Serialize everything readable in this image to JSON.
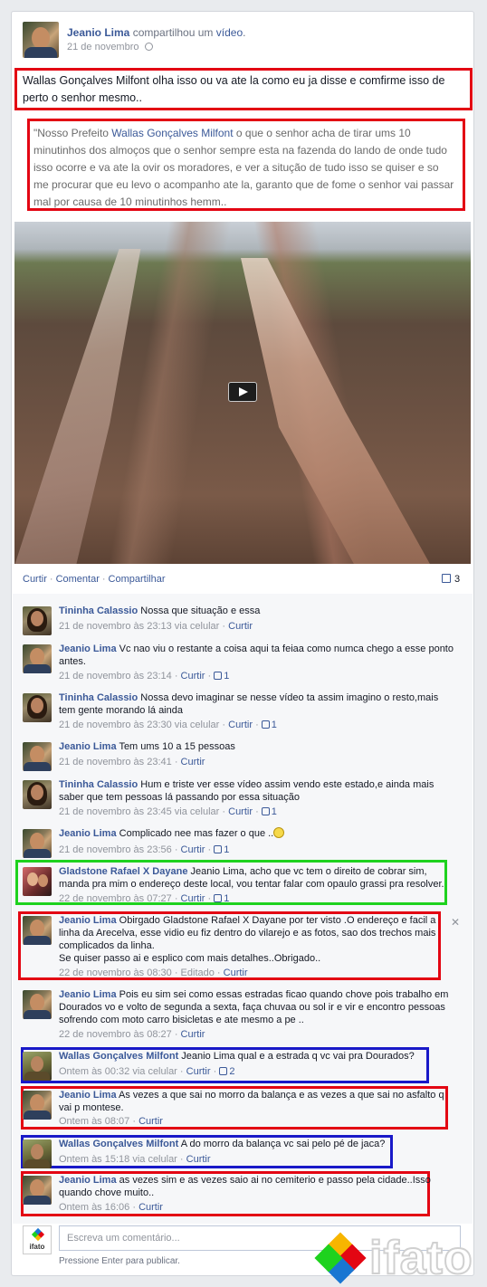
{
  "post": {
    "author": "Jeanio Lima",
    "action_text": "compartilhou um",
    "action_link": "vídeo",
    "action_end": ".",
    "date": "21 de novembro",
    "message": "Wallas Gonçalves Milfont olha isso ou va ate la como eu ja disse e comfirme isso de perto o senhor mesmo..",
    "quote_start": "\"Nosso Prefeito ",
    "quote_link": "Wallas Gonçalves Milfont",
    "quote_rest": " o que o senhor acha de tirar ums 10 minutinhos dos almoços que o senhor sempre esta na fazenda do lando de onde tudo isso ocorre e va ate la ovir os moradores, e ver a situção de tudo isso se quiser e so me procurar que eu levo o acompanho ate la, garanto que de fome o senhor vai passar mal por causa de 10 minutinhos hemm..",
    "actions": [
      "Curtir",
      "Comentar",
      "Compartilhar"
    ],
    "comment_count": "3"
  },
  "comments": [
    {
      "author": "Tininha Calassio",
      "text": "Nossa que situação e essa",
      "time": "21 de novembro às 23:13 via celular",
      "reply": "Curtir",
      "likes": ""
    },
    {
      "author": "Jeanio Lima",
      "text": "Vc nao viu o restante a coisa aqui ta feiaa como numca chego a esse ponto antes.",
      "time": "21 de novembro às 23:14",
      "reply": "Curtir",
      "likes": "1"
    },
    {
      "author": "Tininha Calassio",
      "text": "Nossa devo imaginar se nesse vídeo ta assim imagino o resto,mais tem gente morando lá ainda",
      "time": "21 de novembro às 23:30 via celular",
      "reply": "Curtir",
      "likes": "1"
    },
    {
      "author": "Jeanio Lima",
      "text": "Tem ums 10 a 15 pessoas",
      "time": "21 de novembro às 23:41",
      "reply": "Curtir",
      "likes": ""
    },
    {
      "author": "Tininha Calassio",
      "text": "Hum e triste ver esse vídeo assim vendo este estado,e ainda mais saber que tem pessoas lá passando por essa situação",
      "time": "21 de novembro às 23:45 via celular",
      "reply": "Curtir",
      "likes": "1"
    },
    {
      "author": "Jeanio Lima",
      "text": "Complicado nee mas fazer o que ..",
      "time": "21 de novembro às 23:56",
      "reply": "Curtir",
      "likes": "1"
    },
    {
      "author": "Gladstone Rafael X Dayane",
      "text": "Jeanio Lima, acho que vc tem o direito de cobrar sim, manda pra mim o endereço deste local, vou tentar falar com opaulo grassi pra resolver.",
      "time": "22 de novembro às 07:27",
      "reply": "Curtir",
      "likes": "1"
    },
    {
      "author": "Jeanio Lima",
      "text": "Obirgado Gladstone Rafael X Dayane por ter visto .O endereço e facil a linha da Arecelva, esse vidio eu fiz dentro do vilarejo e as fotos, sao dos trechos mais complicados da linha.",
      "text2": "Se quiser passo ai e esplico com mais detalhes..Obrigado..",
      "time": "22 de novembro às 08:30",
      "edited": "Editado",
      "reply": "Curtir",
      "likes": ""
    },
    {
      "author": "Jeanio Lima",
      "text": "Pois eu sim sei como essas estradas ficao quando chove pois trabalho em Dourados vo e volto de segunda a sexta, faça chuvaa ou sol ir e vir e encontro pessoas sofrendo com moto carro bisicletas e ate mesmo a pe ..",
      "time": "22 de novembro às 08:27",
      "reply": "Curtir",
      "likes": ""
    },
    {
      "author": "Wallas Gonçalves Milfont",
      "text": "Jeanio Lima qual e a estrada q vc vai pra Dourados?",
      "time": "Ontem às 00:32 via celular",
      "reply": "Curtir",
      "likes": "2"
    },
    {
      "author": "Jeanio Lima",
      "text": "As vezes a que sai no morro da balança e as vezes a que sai no asfalto q vai p montese.",
      "time": "Ontem às 08:07",
      "reply": "Curtir",
      "likes": ""
    },
    {
      "author": "Wallas Gonçalves Milfont",
      "text": "A do morro da balança vc sai pelo pé de jaca?",
      "time": "Ontem às 15:18 via celular",
      "reply": "Curtir",
      "likes": ""
    },
    {
      "author": "Jeanio Lima",
      "text": "as vezes sim e as vezes saio ai no cemiterio e passo pela cidade..Isso quando chove muito..",
      "time": "Ontem às 16:06",
      "reply": "Curtir",
      "likes": ""
    }
  ],
  "composer": {
    "placeholder": "Escreva um comentário...",
    "hint": "Pressione Enter para publicar.",
    "avatar_label": "ifato"
  },
  "watermark": {
    "text": "ifato"
  },
  "colors": {
    "link": "#3b5998",
    "highlight_red": "#e30613",
    "highlight_green": "#1ed21e",
    "highlight_blue": "#1919c8"
  }
}
